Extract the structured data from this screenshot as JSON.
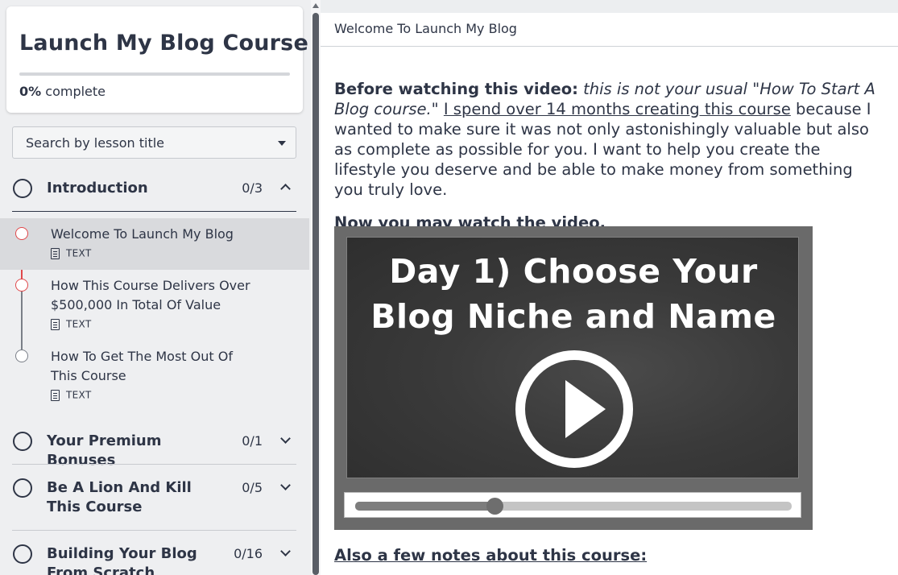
{
  "course": {
    "title": "Launch My Blog Course",
    "progress_value": "0%",
    "progress_suffix": "complete",
    "progress_fraction": 0
  },
  "search": {
    "placeholder": "Search by lesson title"
  },
  "sections": [
    {
      "title": "Introduction",
      "count": "0/3",
      "expanded": true
    },
    {
      "title": "Your Premium Bonuses",
      "count": "0/1",
      "expanded": false
    },
    {
      "title": "Be A Lion And Kill This Course",
      "count": "0/5",
      "expanded": false
    },
    {
      "title": "Building Your Blog From Scratch",
      "count": "0/16",
      "expanded": false
    }
  ],
  "lessons": [
    {
      "title": "Welcome To Launch My Blog",
      "type": "TEXT",
      "active": true
    },
    {
      "title": "How This Course Delivers Over $500,000 In Total Of Value",
      "type": "TEXT",
      "active": false
    },
    {
      "title": "How To Get The Most Out Of This Course",
      "type": "TEXT",
      "active": false
    }
  ],
  "main": {
    "header": "Welcome To Launch My Blog",
    "intro_bold": "Before watching this video:",
    "intro_italic": "this is not your usual \"How To Start A Blog course.\"",
    "intro_underline": "I spend over 14 months creating this course",
    "intro_rest": "because I wanted to make sure it was not only astonishingly valuable but also as complete as possible for you. I want to help you create the lifestyle you deserve and be able to make money from something you truly love.",
    "now_watch": "Now you may watch the video.",
    "video_title_line1": "Day 1) Choose Your",
    "video_title_line2": "Blog Niche and Name",
    "video_progress_fraction": 0.32,
    "notes_heading": "Also a few notes about this course:"
  },
  "colors": {
    "accent": "#e0484b",
    "text": "#2e3546",
    "active_row": "#d9dadd"
  }
}
